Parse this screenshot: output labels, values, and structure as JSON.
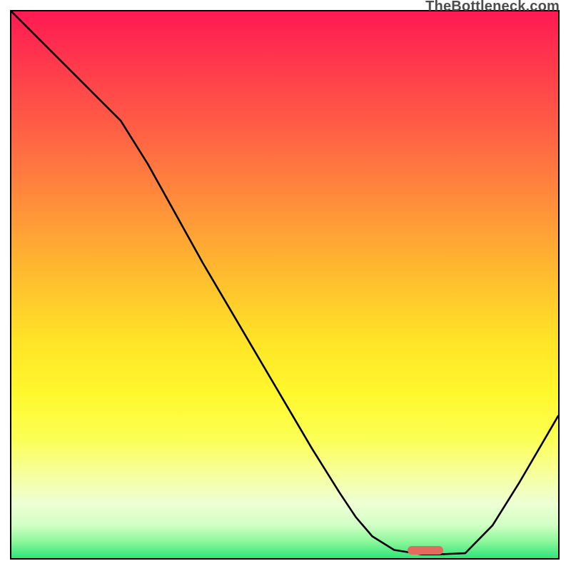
{
  "watermark": "TheBottleneck.com",
  "chart_data": {
    "type": "line",
    "title": "",
    "xlabel": "",
    "ylabel": "",
    "xlim": [
      0,
      100
    ],
    "ylim": [
      0,
      100
    ],
    "grid": false,
    "series": [
      {
        "name": "curve",
        "x": [
          0,
          5,
          10,
          15,
          20,
          25,
          30,
          35,
          40,
          45,
          50,
          55,
          60,
          63,
          66,
          70,
          75,
          78,
          83,
          88,
          93,
          100
        ],
        "y": [
          100,
          95,
          90,
          85,
          80,
          72,
          63,
          54,
          45.5,
          37,
          28.5,
          20,
          12,
          7.5,
          4,
          1.5,
          0.7,
          0.7,
          0.9,
          6,
          14,
          26
        ]
      }
    ],
    "marker": {
      "x_start": 72.5,
      "x_end": 79,
      "y": 0.6,
      "height": 1.6,
      "color": "#e26a5e"
    },
    "background_gradient": {
      "top": "#ff1a52",
      "mid": "#ffe327",
      "bottom": "#2fe47a"
    }
  }
}
